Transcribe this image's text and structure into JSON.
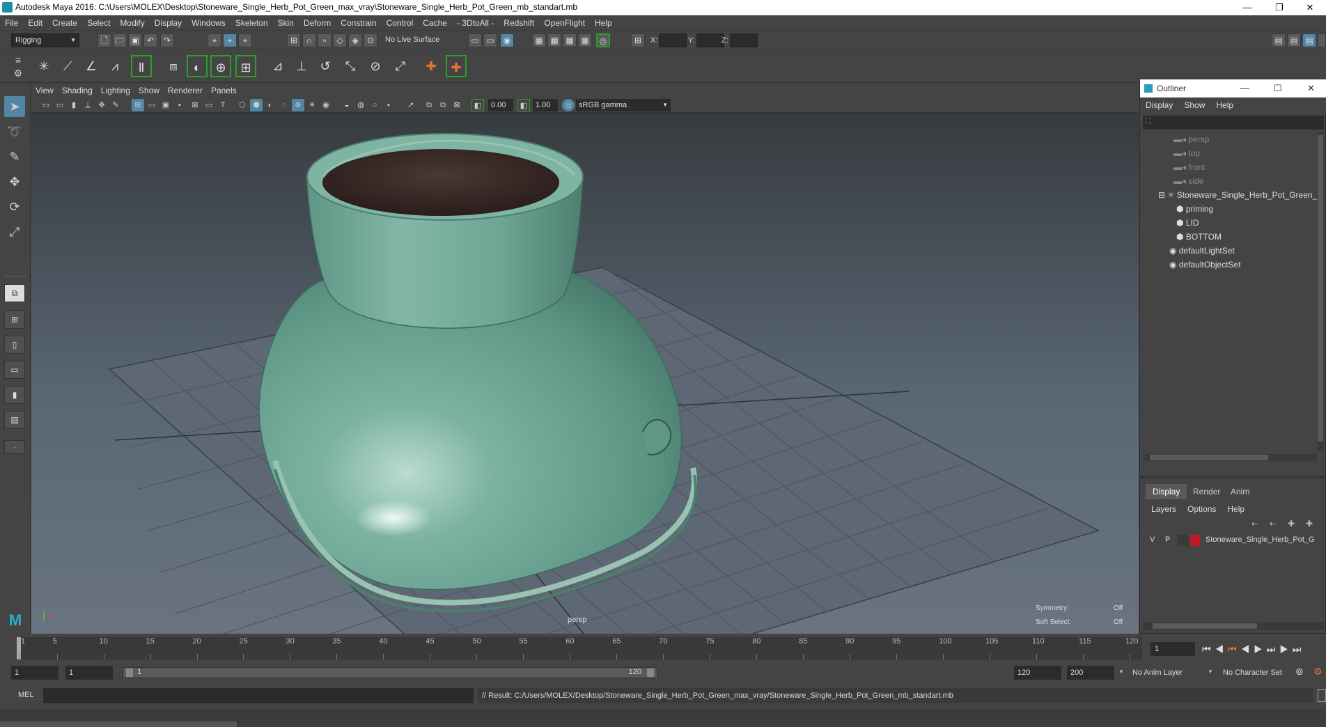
{
  "window": {
    "title": "Autodesk Maya 2016: C:\\Users\\MOLEX\\Desktop\\Stoneware_Single_Herb_Pot_Green_max_vray\\Stoneware_Single_Herb_Pot_Green_mb_standart.mb",
    "minimize": "—",
    "maximize": "❐",
    "close": "✕"
  },
  "menu": [
    "File",
    "Edit",
    "Create",
    "Select",
    "Modify",
    "Display",
    "Windows",
    "Skeleton",
    "Skin",
    "Deform",
    "Constrain",
    "Control",
    "Cache",
    "- 3DtoAll -",
    "Redshift",
    "OpenFlight",
    "Help"
  ],
  "status": {
    "menuset": "Rigging",
    "live_surface": "No Live Surface",
    "x_label": "X:",
    "y_label": "Y:",
    "z_label": "Z:"
  },
  "viewport": {
    "menu": [
      "View",
      "Shading",
      "Lighting",
      "Show",
      "Renderer",
      "Panels"
    ],
    "exposure": "0.00",
    "gamma": "1.00",
    "colorspace": "sRGB gamma",
    "camera": "persp",
    "symmetry_label": "Symmetry:",
    "symmetry_value": "Off",
    "softselect_label": "Soft Select:",
    "softselect_value": "Off"
  },
  "outliner": {
    "title": "Outliner",
    "menu": [
      "Display",
      "Show",
      "Help"
    ],
    "items": [
      {
        "label": "persp",
        "dim": true
      },
      {
        "label": "top",
        "dim": true
      },
      {
        "label": "front",
        "dim": true
      },
      {
        "label": "side",
        "dim": true
      },
      {
        "label": "Stoneware_Single_Herb_Pot_Green_r",
        "dim": false
      },
      {
        "label": "priming",
        "dim": false
      },
      {
        "label": "LID",
        "dim": false
      },
      {
        "label": "BOTTOM",
        "dim": false
      },
      {
        "label": "defaultLightSet",
        "dim": false
      },
      {
        "label": "defaultObjectSet",
        "dim": false
      }
    ]
  },
  "layers": {
    "tabs": [
      "Display",
      "Render",
      "Anim"
    ],
    "menu": [
      "Layers",
      "Options",
      "Help"
    ],
    "layer": {
      "v": "V",
      "p": "P",
      "name": "Stoneware_Single_Herb_Pot_G",
      "color": "#c0182a"
    }
  },
  "timeline": {
    "ticks": [
      "1",
      "5",
      "10",
      "15",
      "20",
      "25",
      "30",
      "35",
      "40",
      "45",
      "50",
      "55",
      "60",
      "65",
      "70",
      "75",
      "80",
      "85",
      "90",
      "95",
      "100",
      "105",
      "110",
      "115",
      "120"
    ],
    "current_frame": "1",
    "start": "1",
    "playback_start": "1",
    "range_start": "1",
    "range_end": "120",
    "playback_end": "120",
    "end": "200",
    "anim_layer": "No Anim Layer",
    "char_set": "No Character Set"
  },
  "command": {
    "lang": "MEL",
    "result": "// Result: C:/Users/MOLEX/Desktop/Stoneware_Single_Herb_Pot_Green_max_vray/Stoneware_Single_Herb_Pot_Green_mb_standart.mb"
  },
  "colors": {
    "accent": "#5285a6",
    "pot": "#6fa595",
    "soil": "#3a2a26"
  }
}
